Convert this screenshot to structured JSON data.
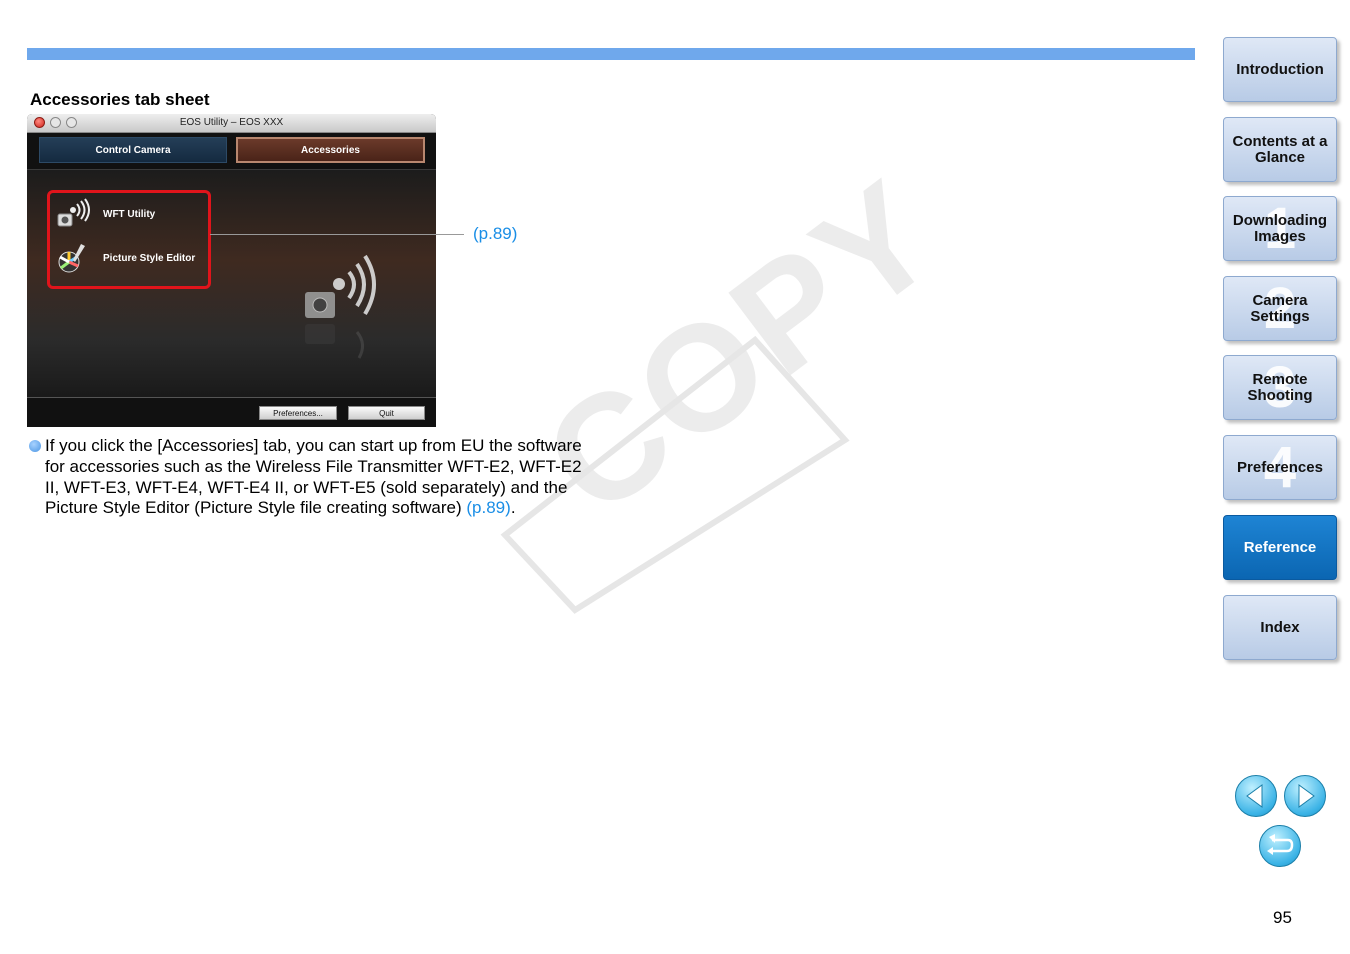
{
  "section_title": "Accessories tab sheet",
  "window": {
    "title": "EOS Utility – EOS XXX",
    "tabs": [
      "Control Camera",
      "Accessories"
    ],
    "accessories": [
      {
        "label": "WFT Utility",
        "icon": "wft-utility-icon"
      },
      {
        "label": "Picture Style Editor",
        "icon": "picture-style-editor-icon"
      }
    ],
    "footer_buttons": [
      "Preferences...",
      "Quit"
    ]
  },
  "callout": "(p.89)",
  "body": {
    "text": "If you click the [Accessories] tab, you can start up from EU the software for accessories such as the Wireless File Transmitter WFT-E2, WFT-E2 II, WFT-E3, WFT-E4, WFT-E4 II, or WFT-E5 (sold separately) and the Picture Style Editor (Picture Style file creating software) ",
    "link": "(p.89)",
    "end": "."
  },
  "watermark": "COPY",
  "sidenav": [
    {
      "label": "Introduction",
      "number": ""
    },
    {
      "label": "Contents at a Glance",
      "number": ""
    },
    {
      "label": "Downloading Images",
      "number": "1"
    },
    {
      "label": "Camera Settings",
      "number": "2"
    },
    {
      "label": "Remote Shooting",
      "number": "3"
    },
    {
      "label": "Preferences",
      "number": "4"
    },
    {
      "label": "Reference",
      "number": "",
      "active": true
    },
    {
      "label": "Index",
      "number": ""
    }
  ],
  "nav_icons": [
    "previous-page-icon",
    "next-page-icon",
    "return-icon"
  ],
  "page_number": "95",
  "colors": {
    "accent_bar": "#6fa8ec",
    "link": "#1a8ee6",
    "active_nav": "#0b66b2",
    "highlight": "#e0141b"
  }
}
